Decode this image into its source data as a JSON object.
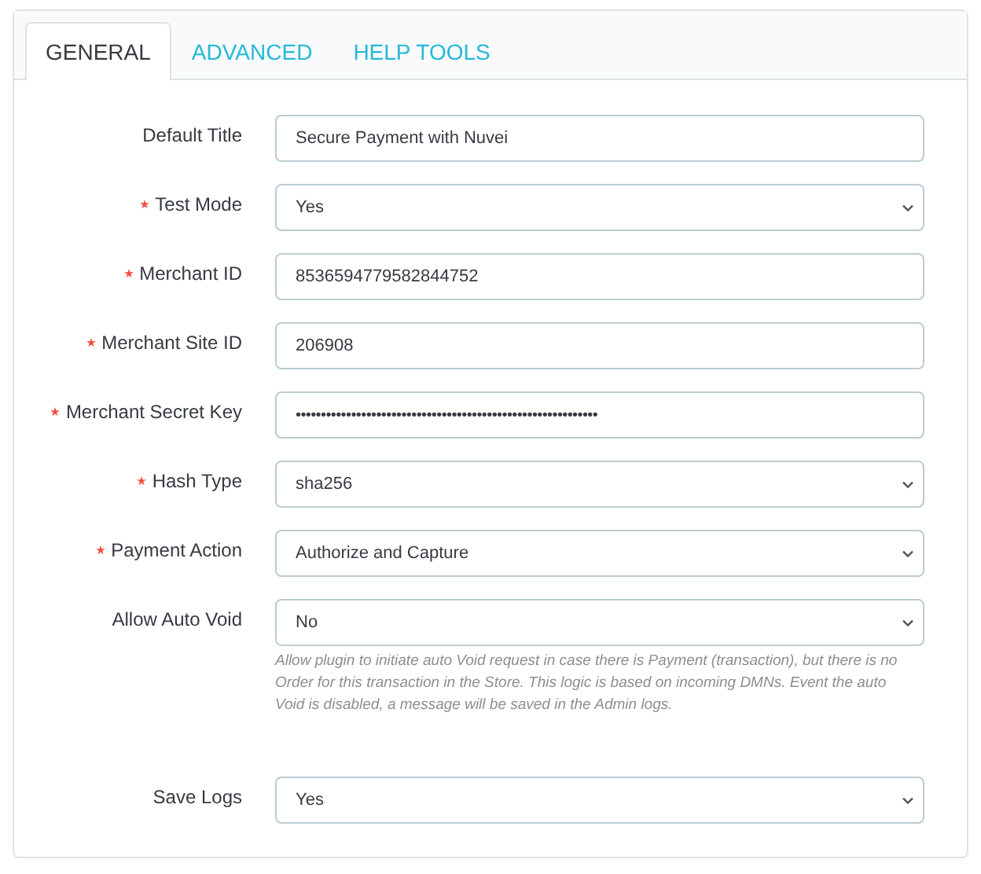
{
  "tabs": [
    {
      "label": "GENERAL",
      "selected": true
    },
    {
      "label": "ADVANCED",
      "selected": false
    },
    {
      "label": "HELP TOOLS",
      "selected": false
    }
  ],
  "fields": [
    {
      "label": "Default Title",
      "required": false,
      "kind": "text",
      "value": "Secure Payment with Nuvei"
    },
    {
      "label": "Test Mode",
      "required": true,
      "kind": "select",
      "value": "Yes"
    },
    {
      "label": "Merchant ID",
      "required": true,
      "kind": "text",
      "value": "8536594779582844752"
    },
    {
      "label": "Merchant Site ID",
      "required": true,
      "kind": "text",
      "value": "206908"
    },
    {
      "label": "Merchant Secret Key",
      "required": true,
      "kind": "password",
      "value": "••••••••••••••••••••••••••••••••••••••••••••••••••••••••••••"
    },
    {
      "label": "Hash Type",
      "required": true,
      "kind": "select",
      "value": "sha256"
    },
    {
      "label": "Payment Action",
      "required": true,
      "kind": "select",
      "value": "Authorize and Capture"
    },
    {
      "label": "Allow Auto Void",
      "required": false,
      "kind": "select",
      "value": "No",
      "help": "Allow plugin to initiate auto Void request in case there is Payment (transaction), but there is no Order for this transaction in the Store. This logic is based on incoming DMNs. Event the auto Void is disabled, a message will be saved in the Admin logs."
    },
    {
      "label": "Save Logs",
      "required": false,
      "kind": "select",
      "value": "Yes"
    }
  ]
}
